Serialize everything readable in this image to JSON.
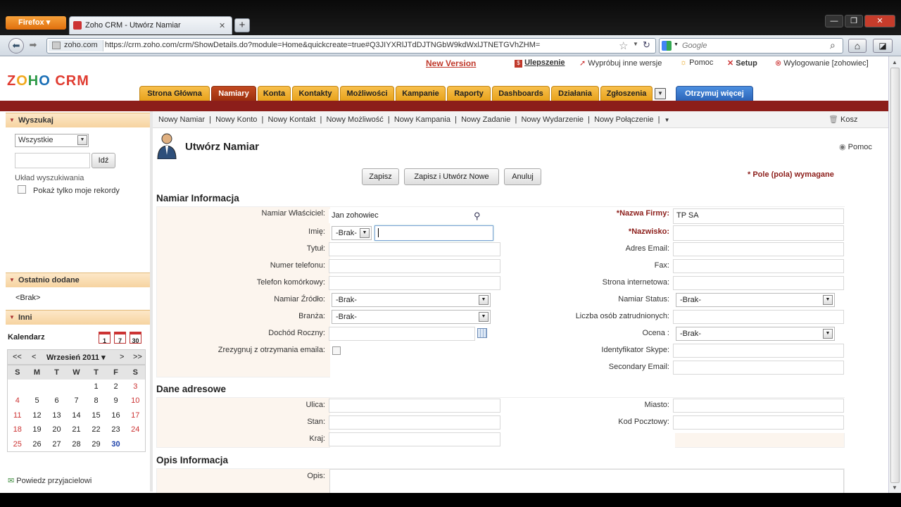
{
  "browser": {
    "menu_label": "Firefox",
    "tab_title": "Zoho CRM - Utwórz Namiar",
    "new_tab": "+",
    "url_domain": "zoho.com",
    "url": "https://crm.zoho.com/crm/ShowDetails.do?module=Home&quickcreate=true#Q3JIYXRlJTdDJTNGbW9kdWxlJTNETGVhZHM=",
    "search_placeholder": "Google"
  },
  "header": {
    "logo": "ZOHO CRM",
    "new_version": "New Version",
    "upgrade": "Ulepszenie",
    "try_editions": "Wypróbuj inne wersje",
    "help": "Pomoc",
    "setup": "Setup",
    "logout": "Wylogowanie [zohowiec]"
  },
  "module_tabs": [
    "Strona Główna",
    "Namiary",
    "Konta",
    "Kontakty",
    "Możliwości",
    "Kampanie",
    "Raporty",
    "Dashboards",
    "Działania",
    "Zgłoszenia"
  ],
  "get_more": "Otrzymuj więcej",
  "sidebar": {
    "search_title": "Wyszukaj",
    "search_scope": "Wszystkie",
    "go_button": "Idź",
    "search_layout": "Układ wyszukiwania",
    "only_my_records": "Pokaż tylko moje rekordy",
    "recent_title": "Ostatnio dodane",
    "recent_empty": "<Brak>",
    "other_title": "Inni",
    "calendar_title": "Kalendarz",
    "cal_icons": [
      "1",
      "7",
      "30"
    ],
    "cal_nav": {
      "prev_year": "<<",
      "prev": "<",
      "month": "Wrzesień 2011 ▾",
      "next": ">",
      "next_year": ">>"
    },
    "weekdays": [
      "S",
      "M",
      "T",
      "W",
      "T",
      "F",
      "S"
    ],
    "weeks": [
      [
        "",
        "",
        "",
        "",
        "1",
        "2",
        "3"
      ],
      [
        "4",
        "5",
        "6",
        "7",
        "8",
        "9",
        "10"
      ],
      [
        "11",
        "12",
        "13",
        "14",
        "15",
        "16",
        "17"
      ],
      [
        "18",
        "19",
        "20",
        "21",
        "22",
        "23",
        "24"
      ],
      [
        "25",
        "26",
        "27",
        "28",
        "29",
        "30",
        ""
      ]
    ],
    "tell_friends": "Powiedz przyjacielowi"
  },
  "subnav": {
    "links": [
      "Nowy Namiar",
      "Nowy Konto",
      "Nowy Kontakt",
      "Nowy Możliwość",
      "Nowy Kampania",
      "Nowy Zadanie",
      "Nowy Wydarzenie",
      "Nowy Połączenie"
    ],
    "trash": "Kosz"
  },
  "page": {
    "title": "Utwórz Namiar",
    "help": "Pomoc",
    "save": "Zapisz",
    "save_new": "Zapisz i Utwórz Nowe",
    "cancel": "Anuluj",
    "required_note": "* Pole (pola) wymagane"
  },
  "sections": {
    "lead_info": "Namiar Informacja",
    "address": "Dane adresowe",
    "description": "Opis Informacja"
  },
  "fields_left": [
    {
      "label": "Namiar Właściciel:",
      "value": "Jan zohowiec",
      "type": "lookup"
    },
    {
      "label": "Imię:",
      "value": "-Brak-",
      "type": "salutation"
    },
    {
      "label": "Tytuł:",
      "value": "",
      "type": "text"
    },
    {
      "label": "Numer telefonu:",
      "value": "",
      "type": "text"
    },
    {
      "label": "Telefon komórkowy:",
      "value": "",
      "type": "text"
    },
    {
      "label": "Namiar Źródło:",
      "value": "-Brak-",
      "type": "select"
    },
    {
      "label": "Branża:",
      "value": "-Brak-",
      "type": "select"
    },
    {
      "label": "Dochód Roczny:",
      "value": "",
      "type": "calc"
    },
    {
      "label": "Zrezygnuj z otrzymania emaila:",
      "value": "",
      "type": "checkbox"
    }
  ],
  "fields_right": [
    {
      "label": "*Nazwa Firmy:",
      "value": "TP SA",
      "type": "text",
      "required": true
    },
    {
      "label": "*Nazwisko:",
      "value": "",
      "type": "text",
      "required": true
    },
    {
      "label": "Adres Email:",
      "value": "",
      "type": "text"
    },
    {
      "label": "Fax:",
      "value": "",
      "type": "text"
    },
    {
      "label": "Strona internetowa:",
      "value": "",
      "type": "text"
    },
    {
      "label": "Namiar Status:",
      "value": "-Brak-",
      "type": "select"
    },
    {
      "label": "Liczba osób zatrudnionych:",
      "value": "",
      "type": "text"
    },
    {
      "label": "Ocena :",
      "value": "-Brak-",
      "type": "select"
    },
    {
      "label": "Identyfikator Skype:",
      "value": "",
      "type": "text"
    },
    {
      "label": "Secondary Email:",
      "value": "",
      "type": "text"
    }
  ],
  "address_left": [
    {
      "label": "Ulica:",
      "value": ""
    },
    {
      "label": "Stan:",
      "value": ""
    },
    {
      "label": "Kraj:",
      "value": ""
    }
  ],
  "address_right": [
    {
      "label": "Miasto:",
      "value": ""
    },
    {
      "label": "Kod Pocztowy:",
      "value": ""
    }
  ],
  "description_label": "Opis:"
}
